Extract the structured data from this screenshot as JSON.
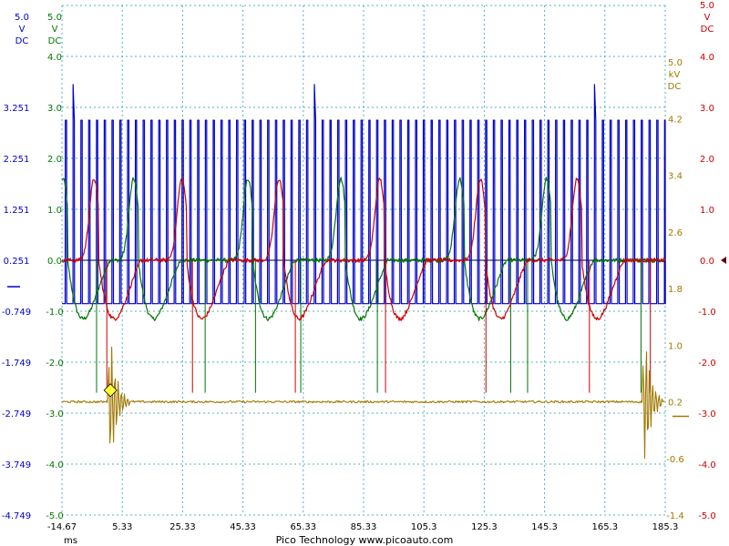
{
  "chart_data": {
    "type": "line",
    "title": "",
    "x_axis": {
      "unit": "ms",
      "range": [
        -14.67,
        185.33
      ],
      "ticks": [
        "-14.67",
        "5.33",
        "25.33",
        "45.33",
        "65.33",
        "85.33",
        "105.3",
        "125.3",
        "145.3",
        "165.3",
        "185.3"
      ]
    },
    "channels": [
      {
        "id": "A",
        "color": "#0000cc",
        "units": [
          "5.0",
          "V",
          "DC"
        ],
        "range": [
          -4.749,
          5.251
        ],
        "ticks": [
          "3.251",
          "2.251",
          "1.251",
          "0.251",
          "-0.749",
          "-1.749",
          "-2.749",
          "-3.749",
          "-4.749"
        ]
      },
      {
        "id": "B",
        "color": "#007700",
        "units": [
          "5.0",
          "V",
          "DC"
        ],
        "range": [
          -5.0,
          5.0
        ],
        "ticks": [
          "4.0",
          "3.0",
          "2.0",
          "1.0",
          "0.0",
          "-1.0",
          "-2.0",
          "-3.0",
          "-4.0",
          "-5.0"
        ]
      },
      {
        "id": "C",
        "color": "#cc0000",
        "units": [
          "5.0",
          "V",
          "DC"
        ],
        "range": [
          -5.0,
          5.0
        ],
        "ticks": [
          "4.0",
          "3.0",
          "2.0",
          "1.0",
          "0.0",
          "-1.0",
          "-2.0",
          "-3.0",
          "-4.0",
          "-5.0"
        ]
      },
      {
        "id": "D",
        "color": "#a07800",
        "units": [
          "kV",
          "DC"
        ],
        "range": [
          -1.4,
          5.8
        ],
        "ticks": [
          "5.0",
          "4.2",
          "3.4",
          "2.6",
          "1.8",
          "1.0",
          "0.2",
          "-0.6",
          "-1.4"
        ]
      }
    ],
    "series": [
      {
        "channel": "A",
        "description": "square wave pulse train, ~2.6 ms period",
        "low": -0.6,
        "high": 3.0,
        "period_ms": 2.58,
        "phase_ms": -13.6,
        "tall_spikes_ms": [
          -11.0,
          69.3,
          160.6
        ]
      },
      {
        "channel": "B",
        "cycle_events_ms": [
          -12.8,
          10.6,
          48.5,
          79.3,
          118.7,
          147.5
        ],
        "spike_ms": [
          -3.2,
          32.8,
          49.5,
          64.5,
          89.9,
          134.1,
          139.7,
          177.3
        ]
      },
      {
        "channel": "C",
        "cycle_events_ms": [
          -2.5,
          26.6,
          58.8,
          92.2,
          125.6,
          157.6
        ],
        "spike_ms": [
          0.2,
          28.6,
          62.7,
          92.6,
          125.9,
          160.2,
          180.4
        ]
      },
      {
        "channel": "D",
        "baseline": 0.2,
        "burst_ms": [
          1.6,
          178.8
        ]
      }
    ],
    "trigger": {
      "time_ms": 1.4,
      "channel_a_level": -2.3
    },
    "grid": true
  },
  "footer": {
    "x_unit": "ms",
    "credit": "Pico Technology   www.picoauto.com"
  }
}
